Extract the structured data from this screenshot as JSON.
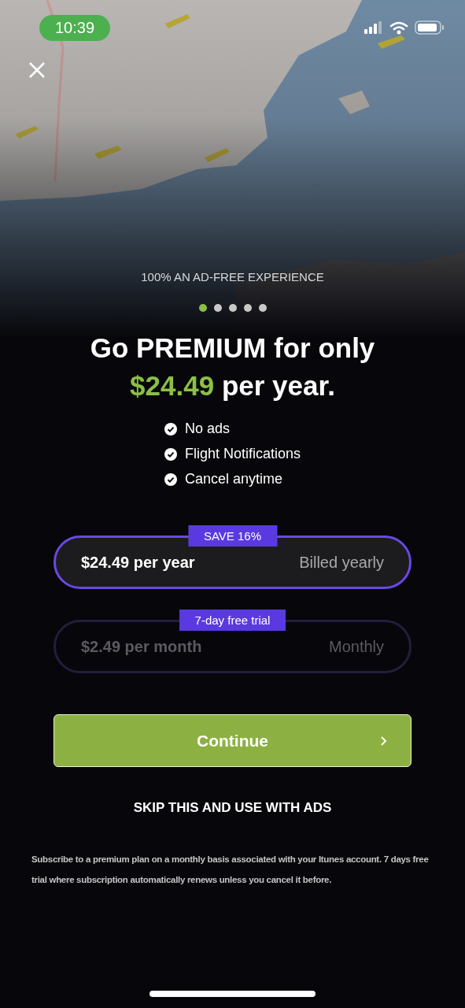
{
  "status_bar": {
    "time": "10:39"
  },
  "caption": "100% AN AD-FREE EXPERIENCE",
  "pager": [
    {
      "selected": true
    },
    {
      "selected": false
    },
    {
      "selected": false
    },
    {
      "selected": false
    },
    {
      "selected": false
    }
  ],
  "headline": {
    "line_1": "Go PREMIUM for only",
    "price": "$24.49",
    "suffix": "per year."
  },
  "features": [
    {
      "label": "No ads",
      "checked": true
    },
    {
      "label": "Flight Notifications",
      "checked": true
    },
    {
      "label": "Cancel anytime",
      "checked": true
    }
  ],
  "plans": [
    {
      "badge": "SAVE 16%",
      "price": "$24.49 per year",
      "billing": "Billed yearly",
      "selected": true
    },
    {
      "badge": "7-day free trial",
      "price": "$2.49 per month",
      "billing": "Monthly",
      "selected": false
    }
  ],
  "continue_button": {
    "label": "Continue"
  },
  "skip_link": "SKIP THIS AND USE WITH ADS",
  "legal_text": "Subscribe to a premium plan on a monthly basis associated with your Itunes account. 7 days free trial where subscription automatically renews unless you cancel it before."
}
